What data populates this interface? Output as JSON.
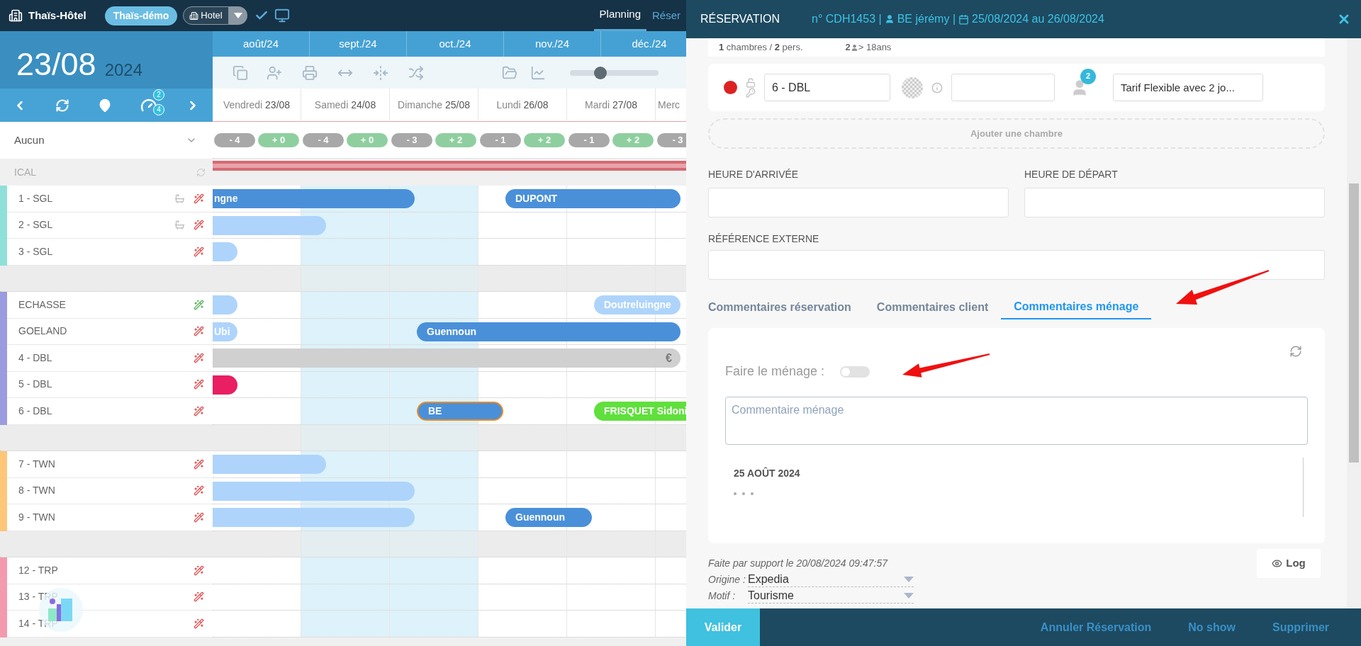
{
  "topbar": {
    "logo_text": "Thaïs-Hôtel",
    "account": "Thaïs-démo",
    "hotel_select": "Hotel",
    "tabs": [
      {
        "label": "Planning",
        "selected": true
      },
      {
        "label": "Réser",
        "selected": false
      }
    ]
  },
  "date": {
    "day": "23/08",
    "year": "2024"
  },
  "nav": {
    "badges": [
      "2",
      "4"
    ]
  },
  "filter": "Aucun",
  "ical_label": "ICAL",
  "months": [
    "août/24",
    "sept./24",
    "oct./24",
    "nov./24",
    "déc./24"
  ],
  "toolbar": {
    "zoom": {
      "level": 0.34
    }
  },
  "days": [
    {
      "label": "Vendredi **23/08**",
      "weekend": false,
      "badges": [
        {
          "text": "- 4",
          "kind": "minus"
        },
        {
          "text": "+ 0",
          "kind": "plus"
        }
      ]
    },
    {
      "label": "Samedi **24/08**",
      "weekend": true,
      "badges": [
        {
          "text": "- 4",
          "kind": "minus"
        },
        {
          "text": "+ 0",
          "kind": "plus"
        }
      ]
    },
    {
      "label": "Dimanche **25/08**",
      "weekend": true,
      "badges": [
        {
          "text": "- 3",
          "kind": "minus"
        },
        {
          "text": "+ 2",
          "kind": "plus"
        }
      ]
    },
    {
      "label": "Lundi **26/08**",
      "weekend": false,
      "badges": [
        {
          "text": "- 1",
          "kind": "minus"
        },
        {
          "text": "+ 2",
          "kind": "plus"
        }
      ]
    },
    {
      "label": "Mardi **27/08**",
      "weekend": false,
      "badges": [
        {
          "text": "- 1",
          "kind": "minus"
        },
        {
          "text": "+ 2",
          "kind": "plus"
        }
      ]
    },
    {
      "label": "Merc",
      "weekend": false,
      "badges": [
        {
          "text": "- 3",
          "kind": "minus"
        }
      ]
    }
  ],
  "groups": [
    {
      "color": "#8ee0d9",
      "rooms": [
        {
          "name": "1 - SGL",
          "bath": true,
          "clean": false,
          "bookings": [
            {
              "guest": "ngne",
              "color": "#4a90d9",
              "selected": false
            },
            {
              "guest": "DUPONT",
              "color": "#4a90d9",
              "selected": false
            }
          ]
        },
        {
          "name": "2 - SGL",
          "bath": true,
          "clean": false,
          "bookings": [
            {
              "color": "#aed4fb",
              "selected": false
            }
          ]
        },
        {
          "name": "3 - SGL",
          "bath": false,
          "clean": false,
          "bookings": [
            {
              "color": "#aed4fb",
              "selected": false
            }
          ]
        }
      ]
    },
    {
      "color": "#9b9be0",
      "rooms": [
        {
          "name": "ECHASSE",
          "bath": false,
          "clean": true,
          "bookings": [
            {
              "color": "#aed4fb",
              "selected": false
            },
            {
              "guest": "Doutreluingne",
              "color": "#aed4fb",
              "selected": false
            }
          ]
        },
        {
          "name": "GOELAND",
          "bath": false,
          "clean": false,
          "bookings": [
            {
              "guest": "Ubi",
              "color": "#aed4fb",
              "selected": false
            },
            {
              "guest": "Guennoun",
              "color": "#4a90d9",
              "selected": false
            }
          ]
        },
        {
          "name": "4 - DBL",
          "bath": false,
          "clean": false,
          "bookings": [
            {
              "note": "€",
              "color": "#d0d0d0",
              "selected": false
            }
          ]
        },
        {
          "name": "5 - DBL",
          "bath": false,
          "clean": false,
          "bookings": [
            {
              "color": "#e91e63",
              "selected": false
            }
          ]
        },
        {
          "name": "6 - DBL",
          "bath": false,
          "clean": false,
          "bookings": [
            {
              "guest": "BE",
              "color": "#4a90d9",
              "selected": true
            },
            {
              "guest": "FRISQUET Sidoni",
              "color": "#5fe03c",
              "selected": false
            }
          ]
        }
      ]
    },
    {
      "color": "#fdc679",
      "rooms": [
        {
          "name": "7 - TWN",
          "bath": false,
          "clean": false,
          "bookings": [
            {
              "color": "#aed4fb",
              "selected": false
            }
          ]
        },
        {
          "name": "8 - TWN",
          "bath": false,
          "clean": false,
          "bookings": [
            {
              "color": "#aed4fb",
              "selected": false
            }
          ]
        },
        {
          "name": "9 - TWN",
          "bath": false,
          "clean": false,
          "bookings": [
            {
              "color": "#aed4fb",
              "selected": false
            },
            {
              "guest": "Guennoun",
              "color": "#4a90d9",
              "selected": false
            }
          ]
        }
      ]
    },
    {
      "color": "#f39aae",
      "rooms": [
        {
          "name": "12 - TRP",
          "bath": false,
          "clean": false
        },
        {
          "name": "13 - TRP",
          "bath": false,
          "clean": false
        },
        {
          "name": "14 - TRP",
          "bath": false,
          "clean": false
        }
      ]
    }
  ],
  "reservation": {
    "title": "RÉSERVATION",
    "number": "n° CDH1453 |",
    "guest": "BE jérémy |",
    "dates": "25/08/2024 au 26/08/2024",
    "summary": {
      "rooms": "**1** chambres / **2** pers.",
      "adults_count": "2",
      "adults_label": "> 18ans"
    },
    "room_line": {
      "color": "#dd2222",
      "room": "6 - DBL",
      "guests_badge": "2",
      "rate": "Tarif Flexible avec 2 jo..."
    },
    "add_room": "Ajouter une chambre",
    "fields": [
      {
        "label": "HEURE D'ARRIVÉE"
      },
      {
        "label": "HEURE DE DÉPART"
      },
      {
        "label": "RÉFÉRENCE EXTERNE"
      }
    ],
    "tabs": [
      {
        "label": "Commentaires réservation",
        "selected": false
      },
      {
        "label": "Commentaires client",
        "selected": false
      },
      {
        "label": "Commentaires ménage",
        "selected": true
      }
    ],
    "cleaning": {
      "label": "Faire le ménage :",
      "on": false,
      "placeholder": "Commentaire ménage",
      "history": [
        {
          "date": "25 AOÛT 2024"
        }
      ]
    },
    "created": "Faite par support le 20/08/2024 09:47:57",
    "selects": [
      {
        "label": "Origine :",
        "value": "Expedia"
      },
      {
        "label": "Motif :",
        "value": "Tourisme"
      }
    ],
    "log_button": "Log",
    "footer": {
      "primary": "Valider",
      "actions": [
        "Annuler Réservation",
        "No show",
        "Supprimer"
      ]
    }
  }
}
